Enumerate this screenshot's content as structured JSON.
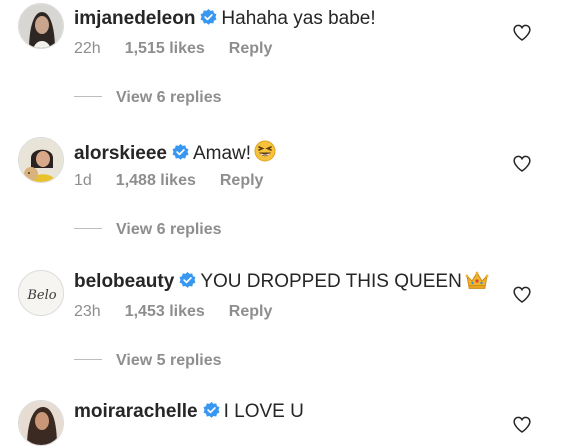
{
  "comments": [
    {
      "username": "imjanedeleon",
      "text": "Hahaha yas babe!",
      "time": "22h",
      "likes": "1,515 likes",
      "reply_label": "Reply",
      "view_replies": "View 6 replies",
      "verified": true
    },
    {
      "username": "alorskieee",
      "text": "Amaw!",
      "emoji": "grinning-squint-emoji",
      "time": "1d",
      "likes": "1,488 likes",
      "reply_label": "Reply",
      "view_replies": "View 6 replies",
      "verified": true
    },
    {
      "username": "belobeauty",
      "text": "YOU DROPPED THIS QUEEN",
      "emoji": "crown-emoji",
      "time": "23h",
      "likes": "1,453 likes",
      "reply_label": "Reply",
      "view_replies": "View 5 replies",
      "verified": true,
      "avatar_text": "Belo"
    },
    {
      "username": "moirarachelle",
      "text": "I LOVE U",
      "verified": true
    }
  ],
  "colors": {
    "verified_blue": "#3897f0",
    "muted_gray": "#8e8e8e",
    "text_dark": "#262626"
  },
  "icons": {
    "like": "heart-outline-icon",
    "verified": "verified-badge-icon"
  }
}
